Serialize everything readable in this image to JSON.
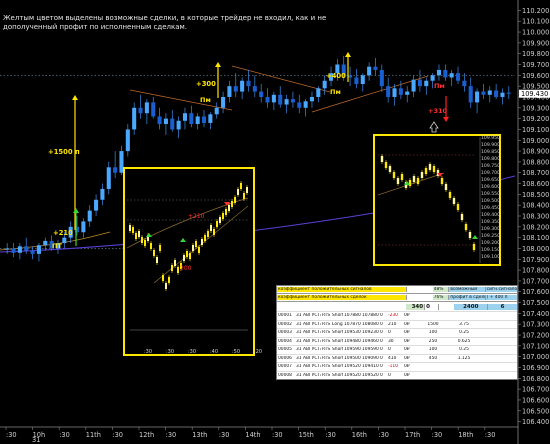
{
  "note": {
    "text": "Желтым цветом выделены возможные сделки, в которые трейдер не входил, как и не дополученный профит по исполненным сделкам."
  },
  "chart_data": {
    "type": "candlestick",
    "y_ticks": [
      "110.200",
      "110.100",
      "110.000",
      "109.900",
      "109.800",
      "109.700",
      "109.600",
      "109.500",
      "109.400",
      "109.300",
      "109.200",
      "109.100",
      "109.000",
      "108.900",
      "108.800",
      "108.700",
      "108.600",
      "108.500",
      "108.400",
      "108.300",
      "108.200",
      "108.100",
      "108.000",
      "107.900",
      "107.800",
      "107.700",
      "107.600",
      "107.500",
      "107.400",
      "107.300",
      "107.200",
      "107.100",
      "107.000",
      "106.900",
      "106.800",
      "106.700",
      "106.600",
      "106.500",
      "106.400"
    ],
    "ylim": [
      106.35,
      110.25
    ],
    "current_price": "109.430",
    "x_ticks": [
      ":30",
      "10h",
      ":30",
      "11th",
      ":30",
      "12th",
      ":30",
      "13th",
      ":30",
      "14th",
      ":30",
      "15th",
      ":30",
      "16th",
      ":30",
      "17th",
      ":30",
      "18th",
      ":30"
    ],
    "x_sub": "31",
    "ohlc": [
      [
        108.0,
        108.05,
        107.95,
        108.0
      ],
      [
        108.0,
        108.05,
        107.92,
        107.96
      ],
      [
        107.96,
        108.05,
        107.9,
        108.02
      ],
      [
        108.02,
        108.1,
        107.95,
        107.98
      ],
      [
        107.98,
        108.02,
        107.9,
        107.95
      ],
      [
        107.95,
        108.05,
        107.88,
        108.03
      ],
      [
        108.03,
        108.1,
        107.98,
        108.07
      ],
      [
        108.07,
        108.12,
        107.98,
        108.0
      ],
      [
        108.0,
        108.08,
        107.95,
        108.05
      ],
      [
        108.05,
        108.15,
        108.0,
        108.1
      ],
      [
        108.1,
        108.25,
        108.05,
        108.2
      ],
      [
        108.2,
        108.3,
        108.12,
        108.15
      ],
      [
        108.15,
        108.28,
        108.1,
        108.25
      ],
      [
        108.25,
        108.4,
        108.2,
        108.35
      ],
      [
        108.35,
        108.5,
        108.3,
        108.45
      ],
      [
        108.45,
        108.6,
        108.4,
        108.55
      ],
      [
        108.55,
        108.8,
        108.5,
        108.75
      ],
      [
        108.75,
        108.9,
        108.65,
        108.7
      ],
      [
        108.7,
        108.95,
        108.68,
        108.9
      ],
      [
        108.9,
        109.15,
        108.85,
        109.1
      ],
      [
        109.1,
        109.35,
        109.05,
        109.3
      ],
      [
        109.3,
        109.42,
        109.2,
        109.25
      ],
      [
        109.25,
        109.38,
        109.15,
        109.35
      ],
      [
        109.35,
        109.4,
        109.2,
        109.22
      ],
      [
        109.22,
        109.3,
        109.1,
        109.15
      ],
      [
        109.15,
        109.25,
        109.05,
        109.2
      ],
      [
        109.2,
        109.28,
        109.08,
        109.1
      ],
      [
        109.1,
        109.22,
        109.02,
        109.18
      ],
      [
        109.18,
        109.3,
        109.1,
        109.25
      ],
      [
        109.25,
        109.32,
        109.12,
        109.15
      ],
      [
        109.15,
        109.25,
        109.1,
        109.22
      ],
      [
        109.22,
        109.28,
        109.12,
        109.16
      ],
      [
        109.16,
        109.26,
        109.1,
        109.24
      ],
      [
        109.24,
        109.35,
        109.2,
        109.3
      ],
      [
        109.3,
        109.45,
        109.25,
        109.4
      ],
      [
        109.4,
        109.55,
        109.35,
        109.5
      ],
      [
        109.5,
        109.62,
        109.4,
        109.45
      ],
      [
        109.45,
        109.58,
        109.38,
        109.55
      ],
      [
        109.55,
        109.65,
        109.45,
        109.5
      ],
      [
        109.5,
        109.6,
        109.4,
        109.45
      ],
      [
        109.45,
        109.52,
        109.35,
        109.4
      ],
      [
        109.4,
        109.48,
        109.3,
        109.35
      ],
      [
        109.35,
        109.45,
        109.28,
        109.42
      ],
      [
        109.42,
        109.5,
        109.3,
        109.33
      ],
      [
        109.33,
        109.42,
        109.25,
        109.38
      ],
      [
        109.38,
        109.45,
        109.3,
        109.35
      ],
      [
        109.35,
        109.42,
        109.25,
        109.3
      ],
      [
        109.3,
        109.38,
        109.22,
        109.36
      ],
      [
        109.36,
        109.45,
        109.3,
        109.4
      ],
      [
        109.4,
        109.5,
        109.35,
        109.48
      ],
      [
        109.48,
        109.6,
        109.42,
        109.55
      ],
      [
        109.55,
        109.68,
        109.5,
        109.62
      ],
      [
        109.62,
        109.75,
        109.55,
        109.7
      ],
      [
        109.7,
        109.78,
        109.55,
        109.6
      ],
      [
        109.6,
        109.68,
        109.5,
        109.58
      ],
      [
        109.58,
        109.66,
        109.48,
        109.52
      ],
      [
        109.52,
        109.62,
        109.45,
        109.6
      ],
      [
        109.6,
        109.72,
        109.55,
        109.68
      ],
      [
        109.68,
        109.76,
        109.6,
        109.65
      ],
      [
        109.65,
        109.7,
        109.45,
        109.5
      ],
      [
        109.5,
        109.58,
        109.35,
        109.4
      ],
      [
        109.4,
        109.52,
        109.32,
        109.48
      ],
      [
        109.48,
        109.55,
        109.38,
        109.42
      ],
      [
        109.42,
        109.5,
        109.35,
        109.45
      ],
      [
        109.45,
        109.6,
        109.4,
        109.56
      ],
      [
        109.56,
        109.65,
        109.45,
        109.5
      ],
      [
        109.5,
        109.58,
        109.42,
        109.55
      ],
      [
        109.55,
        109.62,
        109.48,
        109.6
      ],
      [
        109.6,
        109.7,
        109.55,
        109.65
      ],
      [
        109.65,
        109.7,
        109.55,
        109.58
      ],
      [
        109.58,
        109.65,
        109.5,
        109.62
      ],
      [
        109.62,
        109.68,
        109.52,
        109.55
      ],
      [
        109.55,
        109.62,
        109.45,
        109.5
      ],
      [
        109.5,
        109.58,
        109.3,
        109.35
      ],
      [
        109.35,
        109.48,
        109.25,
        109.45
      ],
      [
        109.45,
        109.52,
        109.38,
        109.42
      ],
      [
        109.42,
        109.5,
        109.35,
        109.46
      ],
      [
        109.46,
        109.52,
        109.38,
        109.4
      ],
      [
        109.4,
        109.48,
        109.33,
        109.44
      ],
      [
        109.44,
        109.5,
        109.38,
        109.43
      ]
    ]
  },
  "annotations": [
    {
      "text": "+1500 п",
      "color": "#ffe600"
    },
    {
      "text": "+210",
      "color": "#ffe600"
    },
    {
      "text": "ПТ",
      "color": "#ffe600"
    },
    {
      "text": "+300",
      "color": "#ffe600"
    },
    {
      "text": "Пм",
      "color": "#ffe600"
    },
    {
      "text": "+400",
      "color": "#ffe600"
    },
    {
      "text": "Пм",
      "color": "#ffe600"
    },
    {
      "text": "Пм",
      "color": "#ff3030"
    },
    {
      "text": "+310",
      "color": "#ff3030"
    }
  ],
  "inset_left": {
    "labels": [
      {
        "text": "+210",
        "color": "#ff3030"
      },
      {
        "text": "200",
        "color": "#ff3030"
      }
    ],
    "x_ticks": [
      ":30",
      ":30",
      ":30",
      ":40",
      ":50",
      ":20"
    ]
  },
  "inset_right": {
    "y_ticks": [
      "109.950",
      "109.900",
      "109.850",
      "109.800",
      "109.750",
      "109.700",
      "109.650",
      "109.600",
      "109.550",
      "109.500",
      "109.450",
      "109.400",
      "109.350",
      "109.300",
      "109.250",
      "109.200",
      "109.150",
      "109.100"
    ]
  },
  "table": {
    "header1": "коэффициент положительных сигналов",
    "header2": "коэффициент положительных сделок",
    "col_possible": "возможный",
    "col_possible2": "профит в сделках",
    "col_score": "сигн.сигналов",
    "col_score2": "( + 400 п",
    "summary": [
      "340",
      "0",
      "2400",
      "6"
    ],
    "pct": [
      "48%",
      "76%"
    ],
    "rows": [
      [
        "00001",
        "31 АВГУСТА",
        "RTS",
        "Short",
        "107880",
        "107880",
        "0",
        "-230",
        "0₽",
        "",
        ""
      ],
      [
        "00002",
        "31 АВГУСТА",
        "RTS",
        "Long",
        "107870",
        "108080",
        "0",
        "210",
        "0₽",
        "1500",
        "3.75"
      ],
      [
        "00003",
        "31 АВГУСТА",
        "RTS",
        "Short",
        "109530",
        "109230",
        "0",
        "0",
        "0₽",
        "100",
        "0.25"
      ],
      [
        "00004",
        "31 АВГУСТА",
        "RTS",
        "Short",
        "109480",
        "109460",
        "0",
        "30",
        "0₽",
        "250",
        "0.625"
      ],
      [
        "00005",
        "31 АВГУСТА",
        "RTS",
        "Short",
        "109590",
        "109590",
        "0",
        "0",
        "0₽",
        "100",
        "0.25"
      ],
      [
        "00006",
        "31 АВГУСТА",
        "RTS",
        "Short",
        "109500",
        "109090",
        "0",
        "410",
        "0₽",
        "450",
        "1.125"
      ],
      [
        "00007",
        "31 АВГУСТА",
        "RTS",
        "Short",
        "109520",
        "109410",
        "0",
        "-110",
        "0₽",
        "",
        ""
      ],
      [
        "00008",
        "31 АВГУСТА",
        "RTS",
        "Short",
        "109520",
        "109520",
        "0",
        "0",
        "0₽",
        "",
        ""
      ]
    ]
  }
}
